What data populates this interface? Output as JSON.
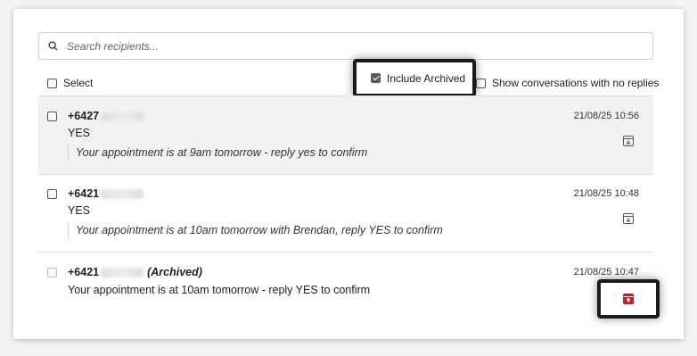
{
  "search": {
    "placeholder": "Search recipients..."
  },
  "filters": {
    "select_label": "Select",
    "include_archived_label": "Include Archived",
    "include_archived_checked": true,
    "no_replies_label": "Show conversations with no replies"
  },
  "conversations": [
    {
      "phone": "+6427",
      "reply": "YES",
      "message": "Your appointment is at 9am tomorrow - reply yes to confirm",
      "timestamp": "21/08/25 10:56",
      "archived": false,
      "action_icon": "archive-icon"
    },
    {
      "phone": "+6421",
      "reply": "YES",
      "message": "Your appointment is at 10am tomorrow with Brendan, reply YES to confirm",
      "timestamp": "21/08/25 10:48",
      "archived": false,
      "action_icon": "archive-icon"
    },
    {
      "phone": "+6421",
      "archived_label": "(Archived)",
      "message": "Your appointment is at 10am tomorrow - reply YES to confirm",
      "timestamp": "21/08/25 10:47",
      "archived": true,
      "action_icon": "unarchive-icon"
    }
  ],
  "colors": {
    "unarchive_accent": "#c0202a",
    "row_highlight": "#f2f2f2"
  }
}
